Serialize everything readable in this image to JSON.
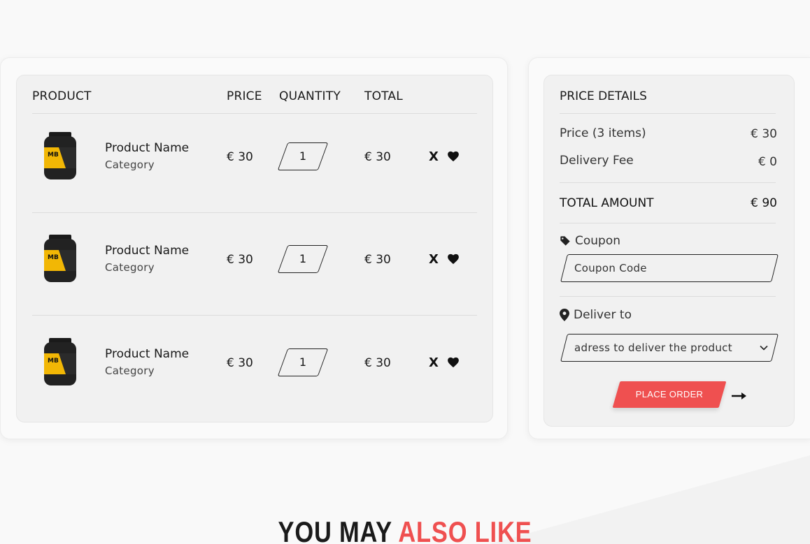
{
  "cart": {
    "headers": {
      "product": "PRODUCT",
      "price": "PRICE",
      "quantity": "QUANTITY",
      "total": "TOTAL"
    },
    "items": [
      {
        "name": "Product Name",
        "category": "Category",
        "price": "€ 30",
        "quantity": "1",
        "total": "€ 30",
        "remove_label": "X",
        "thumb_label": "MB"
      },
      {
        "name": "Product Name",
        "category": "Category",
        "price": "€ 30",
        "quantity": "1",
        "total": "€ 30",
        "remove_label": "X",
        "thumb_label": "MB"
      },
      {
        "name": "Product Name",
        "category": "Category",
        "price": "€ 30",
        "quantity": "1",
        "total": "€ 30",
        "remove_label": "X",
        "thumb_label": "MB"
      }
    ]
  },
  "price_details": {
    "title": "PRICE DETAILS",
    "price_label": "Price (3 items)",
    "price_value": "€ 30",
    "delivery_label": "Delivery Fee",
    "delivery_value": "€ 0",
    "total_label": "TOTAL AMOUNT",
    "total_value": "€ 90",
    "coupon_label": "Coupon",
    "coupon_placeholder": "Coupon Code",
    "deliver_label": "Deliver to",
    "deliver_selected": "adress to deliver the product",
    "order_button": "PLACE ORDER"
  },
  "also_like": {
    "part1": "YOU MAY",
    "part2": "ALSO LIKE"
  },
  "colors": {
    "accent": "#ef5050",
    "panel": "#f1f1f1",
    "text": "#1a1a1a"
  },
  "icons": {
    "coupon": "tag-icon",
    "deliver": "map-pin-icon",
    "wishlist": "heart-icon",
    "order": "arrow-right-icon",
    "select": "chevron-down-icon"
  }
}
